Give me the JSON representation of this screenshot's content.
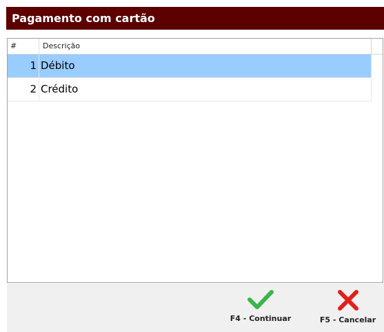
{
  "dialog": {
    "title": "Pagamento com cartão"
  },
  "grid": {
    "columns": [
      "#",
      "Descrição"
    ],
    "rows": [
      {
        "num": "1",
        "desc": "Débito",
        "selected": true
      },
      {
        "num": "2",
        "desc": "Crédito",
        "selected": false
      }
    ]
  },
  "footer": {
    "continue_label": "F4 - Continuar",
    "cancel_label": "F5 - Cancelar",
    "continue_icon": "checkmark-icon",
    "cancel_icon": "x-icon"
  },
  "colors": {
    "title_bar": "#5c0000",
    "selection": "#99ccff",
    "continue_icon": "#3cb54a",
    "cancel_icon": "#e0201b"
  }
}
